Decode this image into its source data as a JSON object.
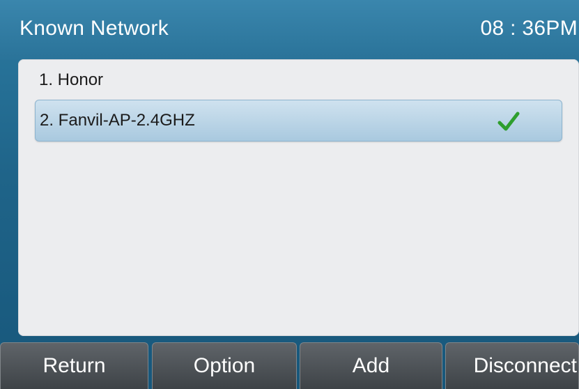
{
  "header": {
    "title": "Known Network",
    "clock": "08 : 36PM"
  },
  "networks": [
    {
      "label": "1. Honor",
      "selected": false,
      "connected": false
    },
    {
      "label": "2. Fanvil-AP-2.4GHZ",
      "selected": true,
      "connected": true,
      "icon": "check-icon"
    }
  ],
  "softkeys": {
    "return_label": "Return",
    "option_label": "Option",
    "add_label": "Add",
    "disconnect_label": "Disconnect"
  },
  "colors": {
    "accent_blue": "#2a7399",
    "selection": "#a9c9df",
    "check_green": "#2e9e2e"
  }
}
